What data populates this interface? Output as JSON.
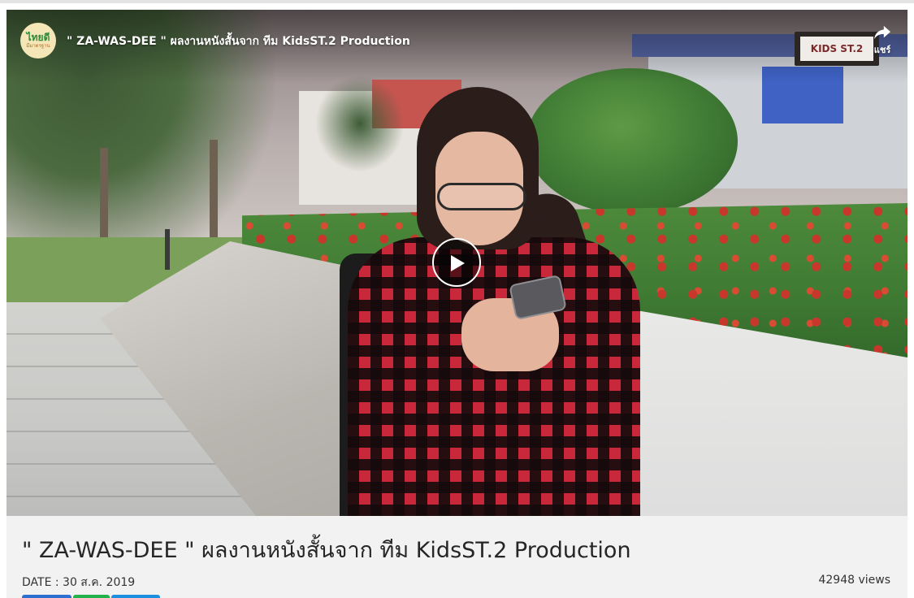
{
  "player": {
    "title": "\" ZA-WAS-DEE \" ผลงานหนังสั้นจาก ทีม KidsST.2 Production",
    "channel_logo_line1": "ไทยดี",
    "channel_logo_line2": "มีมาตรฐาน",
    "share_label": "แชร์",
    "watermark_text": "KIDS ST.2",
    "play_icon": "play-icon",
    "share_icon": "share-arrow-icon"
  },
  "info": {
    "title": "\" ZA-WAS-DEE \" ผลงานหนังสั้นจาก ทีม KidsST.2 Production",
    "date": "DATE : 30 ส.ค. 2019",
    "views": "42948 views"
  },
  "social_buttons": [
    {
      "name": "facebook",
      "color": "#2d6fd1"
    },
    {
      "name": "line",
      "color": "#22b24c"
    },
    {
      "name": "twitter",
      "color": "#1d8fe0"
    }
  ]
}
